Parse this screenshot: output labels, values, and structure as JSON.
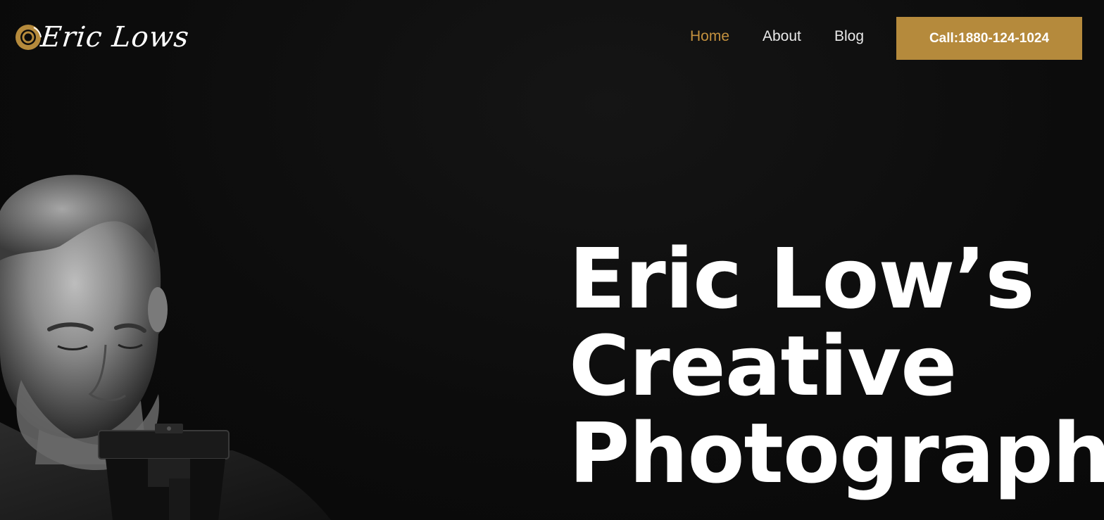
{
  "header": {
    "logo_text": "Eric Lows",
    "nav": [
      {
        "label": "Home",
        "active": true
      },
      {
        "label": "About",
        "active": false
      },
      {
        "label": "Blog",
        "active": false
      }
    ],
    "cta_label": "Call:1880-124-1024"
  },
  "hero": {
    "title_lines": [
      "Eric Low’s",
      "Creative",
      "Photograph"
    ]
  },
  "colors": {
    "accent": "#b58a3c",
    "nav_active": "#c4913e",
    "background": "#0b0b0b",
    "text": "#ffffff"
  },
  "icons": {
    "logo_mark": "camera-lens-icon"
  }
}
